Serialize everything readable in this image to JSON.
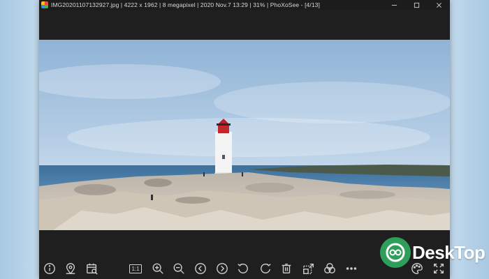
{
  "window": {
    "title": "IMG20201107132927.jpg  |  4222 x 1962  |  8 megapixel  |  2020 Nov.7 13:29  |  31%  |  PhoXoSee  -  [4/13]",
    "controls": [
      "minimize-icon",
      "maximize-icon",
      "close-icon"
    ]
  },
  "toolbar": {
    "ratio_label": "1:1",
    "icons": [
      "info-icon",
      "location-pin-icon",
      "calendar-search-icon",
      "actual-size-icon",
      "zoom-in-icon",
      "zoom-out-icon",
      "previous-icon",
      "next-icon",
      "rotate-left-icon",
      "rotate-right-icon",
      "delete-icon",
      "resize-icon",
      "effects-icon",
      "more-icon",
      "palette-icon",
      "fullscreen-icon"
    ]
  },
  "watermark": {
    "text": "DeskTop"
  }
}
